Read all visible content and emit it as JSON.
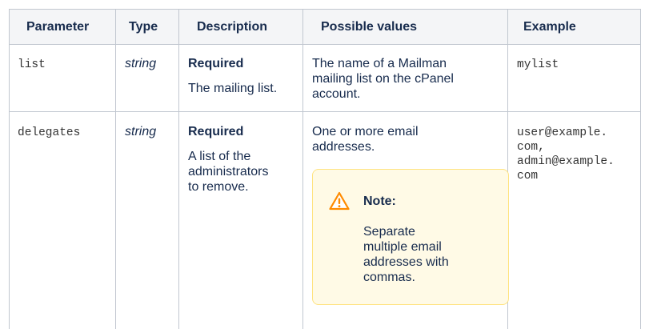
{
  "headers": {
    "parameter": "Parameter",
    "type": "Type",
    "description": "Description",
    "possible_values": "Possible values",
    "example": "Example"
  },
  "rows": [
    {
      "parameter": "list",
      "type": "string",
      "required": "Required",
      "description": "The mailing list.",
      "possible_values": [
        "The name of a Mailman",
        "mailing list on the cPanel",
        "account."
      ],
      "example": [
        "mylist"
      ]
    },
    {
      "parameter": "delegates",
      "type": "string",
      "required": "Required",
      "description": [
        "A list of the",
        "administrators",
        "to remove."
      ],
      "possible_values": [
        "One or more email",
        "addresses."
      ],
      "note": {
        "title": "Note:",
        "lines": [
          "Separate",
          "multiple email",
          "addresses with",
          "commas."
        ]
      },
      "example": [
        "user@example.",
        "com,",
        "admin@example.",
        "com"
      ]
    }
  ],
  "colors": {
    "header_bg": "#f4f5f7",
    "border": "#c1c7d0",
    "note_bg": "#fffae6",
    "note_border": "#ffe380",
    "warning_icon": "#ff8b00"
  }
}
